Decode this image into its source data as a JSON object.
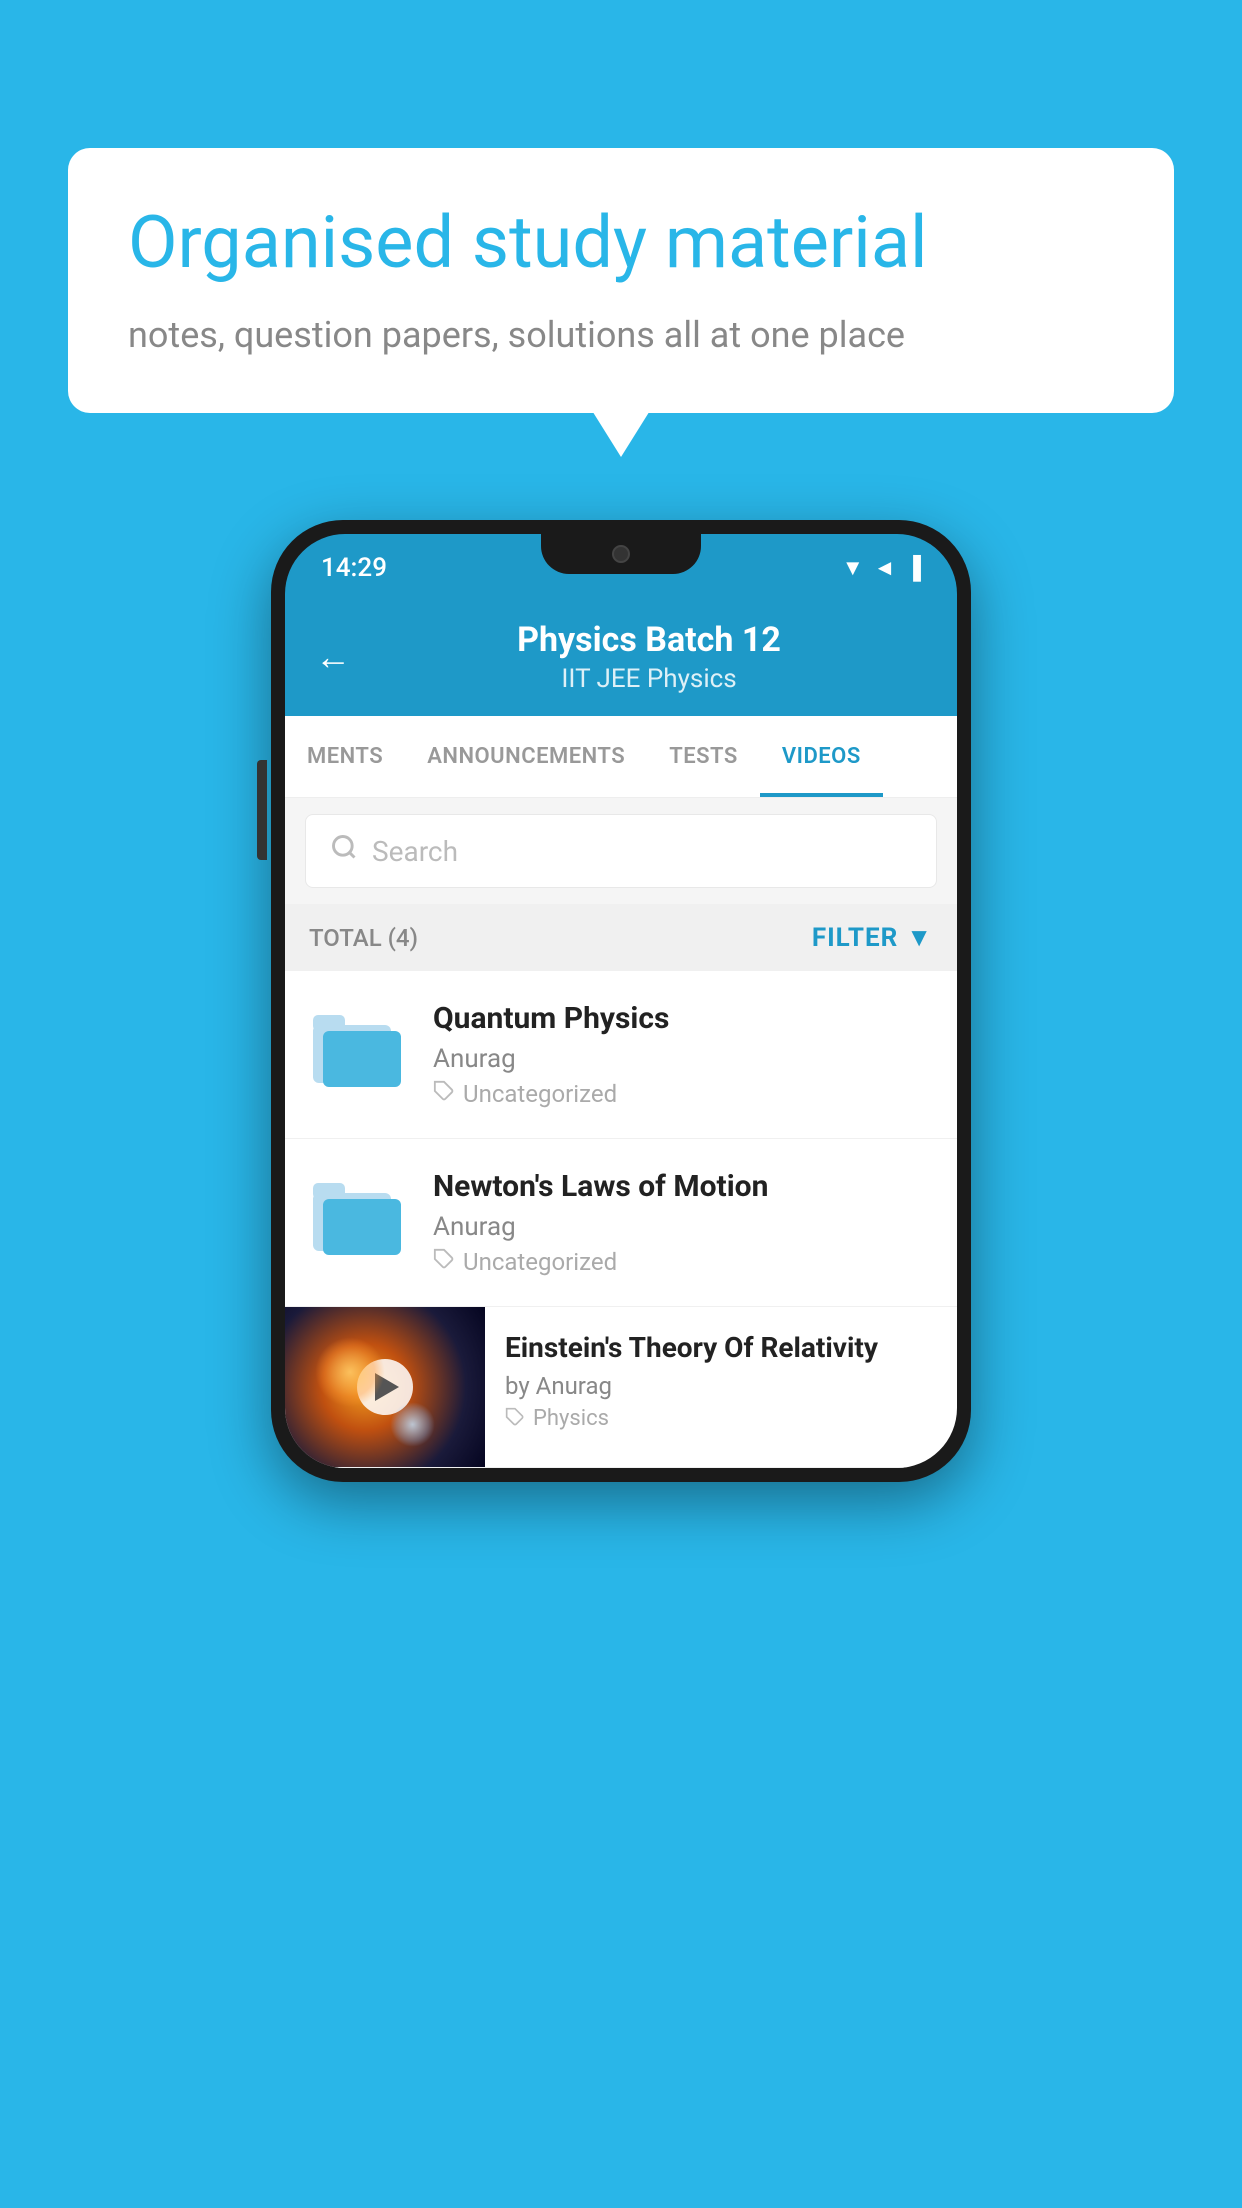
{
  "background_color": "#29b6e8",
  "speech_bubble": {
    "title": "Organised study material",
    "subtitle": "notes, question papers, solutions all at one place"
  },
  "phone": {
    "status_bar": {
      "time": "14:29",
      "icons": "▼◄▐"
    },
    "header": {
      "back_label": "←",
      "title": "Physics Batch 12",
      "tags": "IIT JEE    Physics"
    },
    "tabs": [
      {
        "label": "MENTS",
        "active": false
      },
      {
        "label": "ANNOUNCEMENTS",
        "active": false
      },
      {
        "label": "TESTS",
        "active": false
      },
      {
        "label": "VIDEOS",
        "active": true
      }
    ],
    "search": {
      "placeholder": "Search"
    },
    "filter_bar": {
      "total_label": "TOTAL (4)",
      "filter_label": "FILTER"
    },
    "video_list": [
      {
        "id": "quantum",
        "title": "Quantum Physics",
        "author": "Anurag",
        "tag": "Uncategorized",
        "type": "folder"
      },
      {
        "id": "newton",
        "title": "Newton's Laws of Motion",
        "author": "Anurag",
        "tag": "Uncategorized",
        "type": "folder"
      },
      {
        "id": "einstein",
        "title": "Einstein's Theory Of Relativity",
        "author": "by Anurag",
        "tag": "Physics",
        "type": "video"
      }
    ]
  }
}
